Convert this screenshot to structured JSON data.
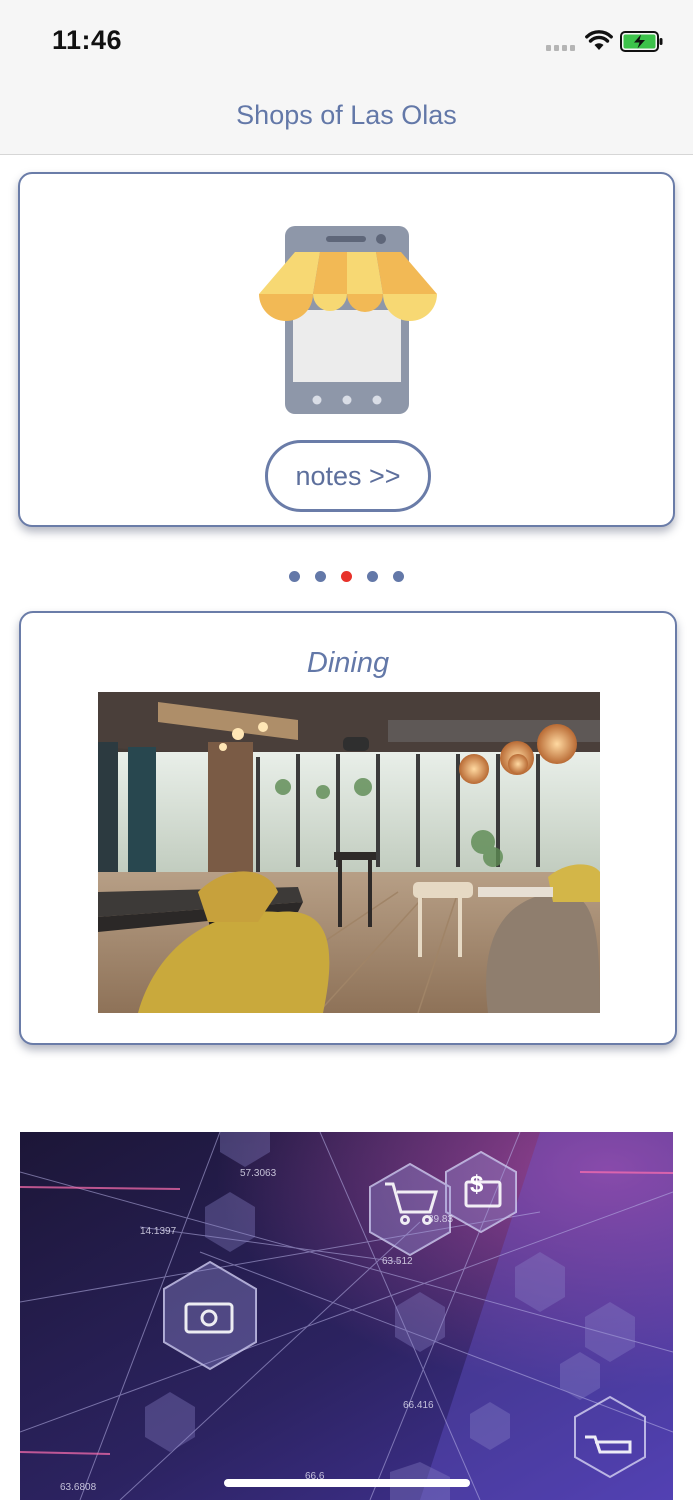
{
  "status_bar": {
    "time": "11:46"
  },
  "nav": {
    "title": "Shops of Las Olas"
  },
  "notes_card": {
    "icon": "mobile-shop-icon",
    "button_label": "notes >>"
  },
  "pager": {
    "count": 5,
    "active_index": 2,
    "colors": {
      "inactive": "#6378a8",
      "active": "#e8322a"
    }
  },
  "dining_card": {
    "title": "Dining",
    "image": "restaurant-interior-photo"
  },
  "banner": {
    "image": "digital-commerce-network-graphic",
    "labels": [
      "57.3063",
      "14.1397",
      "39.83",
      "63.512",
      "66.416",
      "63.6808",
      "66.6"
    ]
  },
  "colors": {
    "accent": "#6378a8",
    "card_border": "#6a7ca8",
    "active_dot": "#e8322a"
  }
}
